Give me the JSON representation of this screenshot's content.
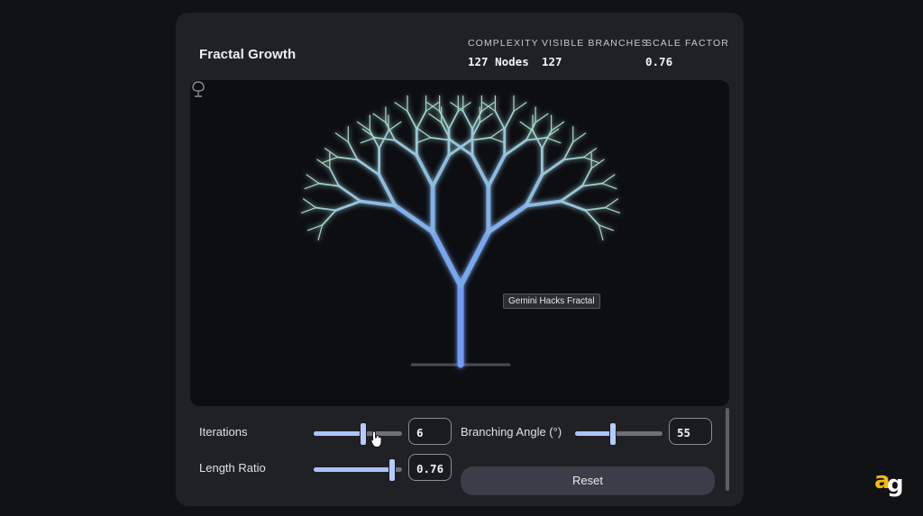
{
  "app": {
    "title": "Fractal Growth"
  },
  "stats": [
    {
      "label": "COMPLEXITY",
      "value": "127 Nodes"
    },
    {
      "label": "VISIBLE BRANCHES",
      "value": "127"
    },
    {
      "label": "SCALE FACTOR",
      "value": "0.76"
    }
  ],
  "canvas": {
    "tooltip": "Gemini Hacks Fractal",
    "tree": {
      "iterations": 6,
      "branching_angle_deg": 55,
      "length_ratio": 0.76
    },
    "colors": {
      "trunk": "#6f9cf5",
      "leaf": "#a9dccb",
      "background": "#0d0e12"
    },
    "footer_icon": "tree-icon"
  },
  "controls": {
    "iterations": {
      "label": "Iterations",
      "value": "6",
      "fraction": 0.55
    },
    "branching_angle": {
      "label": "Branching Angle (°)",
      "value": "55",
      "fraction": 0.42
    },
    "length_ratio": {
      "label": "Length Ratio",
      "value": "0.76",
      "fraction": 0.88
    },
    "reset_label": "Reset"
  },
  "brand": {
    "logo_text": "ag",
    "colors": [
      "#f2b90f",
      "#ffffff"
    ]
  }
}
